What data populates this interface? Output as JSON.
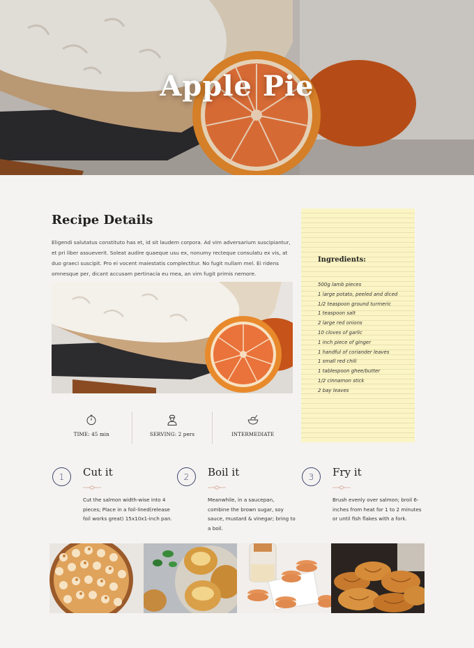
{
  "hero": {
    "title": "Apple Pie"
  },
  "details": {
    "title": "Recipe Details",
    "text": "Eligendi salutatus constituto has et, id sit laudem corpora. Ad vim adversarium suscipiantur, et pri liber assueverit. Soleat audire quaeque usu ex, nonumy recteque consulatu ex vis, at duo graeci suscipit. Pro ei vocent maiestatis complectitur. No fugit nullam mel. Ei ridens omnesque per, dicant accusam pertinacia eu mea, an vim fugit primis nemore."
  },
  "stats": [
    {
      "icon": "timer-icon",
      "label": "TIME: 45 min"
    },
    {
      "icon": "chef-icon",
      "label": "SERVING: 2 pers"
    },
    {
      "icon": "bowl-icon",
      "label": "INTERMEDIATE"
    }
  ],
  "ingredients": {
    "title": "Ingredients:",
    "items": [
      "500g lamb pieces",
      "1 large potato, peeled and diced",
      "1/2 teaspoon ground turmeric",
      "1 teaspoon salt",
      "2 large red onions",
      "10 cloves of garlic",
      "1 inch piece of ginger",
      "1 handful of coriander leaves",
      "1 small red chili",
      "1 tablespoon ghee/butter",
      "1/2 cinnamon stick",
      "2 bay leaves"
    ]
  },
  "steps": [
    {
      "number": "1",
      "title": "Cut it",
      "text": "Cut the salmon width-wise into 4 pieces; Place in a foil-lined(release foil works great) 15x10x1-inch pan."
    },
    {
      "number": "2",
      "title": "Boil it",
      "text": "Meanwhile, in a saucepan, combine the brown sugar, soy sauce, mustard & vinegar; bring to a boil."
    },
    {
      "number": "3",
      "title": "Fry it",
      "text": "Brush evenly over salmon; broil 6-inches from heat for 1 to 2 minutes or until fish flakes with a fork."
    }
  ],
  "colors": {
    "accent": "#3d4470",
    "notepad": "#fbf4c4",
    "background": "#f5f3f1"
  },
  "gallery": [
    "meringue-tart-photo",
    "bread-buns-photo",
    "macarons-photo",
    "croissants-photo"
  ]
}
